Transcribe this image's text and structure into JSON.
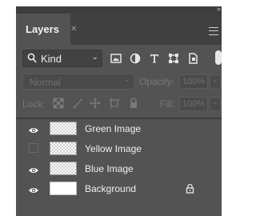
{
  "panel": {
    "tab_title": "Layers",
    "filter": {
      "kind_label": "Kind"
    },
    "blend_mode": "Normal",
    "opacity": {
      "label": "Opacity:",
      "value": "100%"
    },
    "lock_label": "Lock:",
    "fill": {
      "label": "Fill:",
      "value": "100%"
    }
  },
  "layers": [
    {
      "name": "Green Image",
      "visible": true,
      "thumbnail": "transparent",
      "locked": false
    },
    {
      "name": "Yellow Image",
      "visible": false,
      "thumbnail": "transparent",
      "locked": false
    },
    {
      "name": "Blue Image",
      "visible": true,
      "thumbnail": "transparent",
      "locked": false
    },
    {
      "name": "Background",
      "visible": true,
      "thumbnail": "white",
      "locked": true
    }
  ],
  "icons": {
    "filter": [
      "image-filter-icon",
      "adjustment-filter-icon",
      "type-filter-icon",
      "shape-filter-icon",
      "smart-object-filter-icon"
    ],
    "lock": [
      "lock-transparent-pixels-icon",
      "lock-image-pixels-icon",
      "lock-position-icon",
      "lock-artboard-icon",
      "lock-all-icon"
    ]
  },
  "colors": {
    "panel_bg": "#535353",
    "tab_bar_bg": "#404040",
    "text": "#f0f0f0",
    "disabled_text": "#777777"
  }
}
